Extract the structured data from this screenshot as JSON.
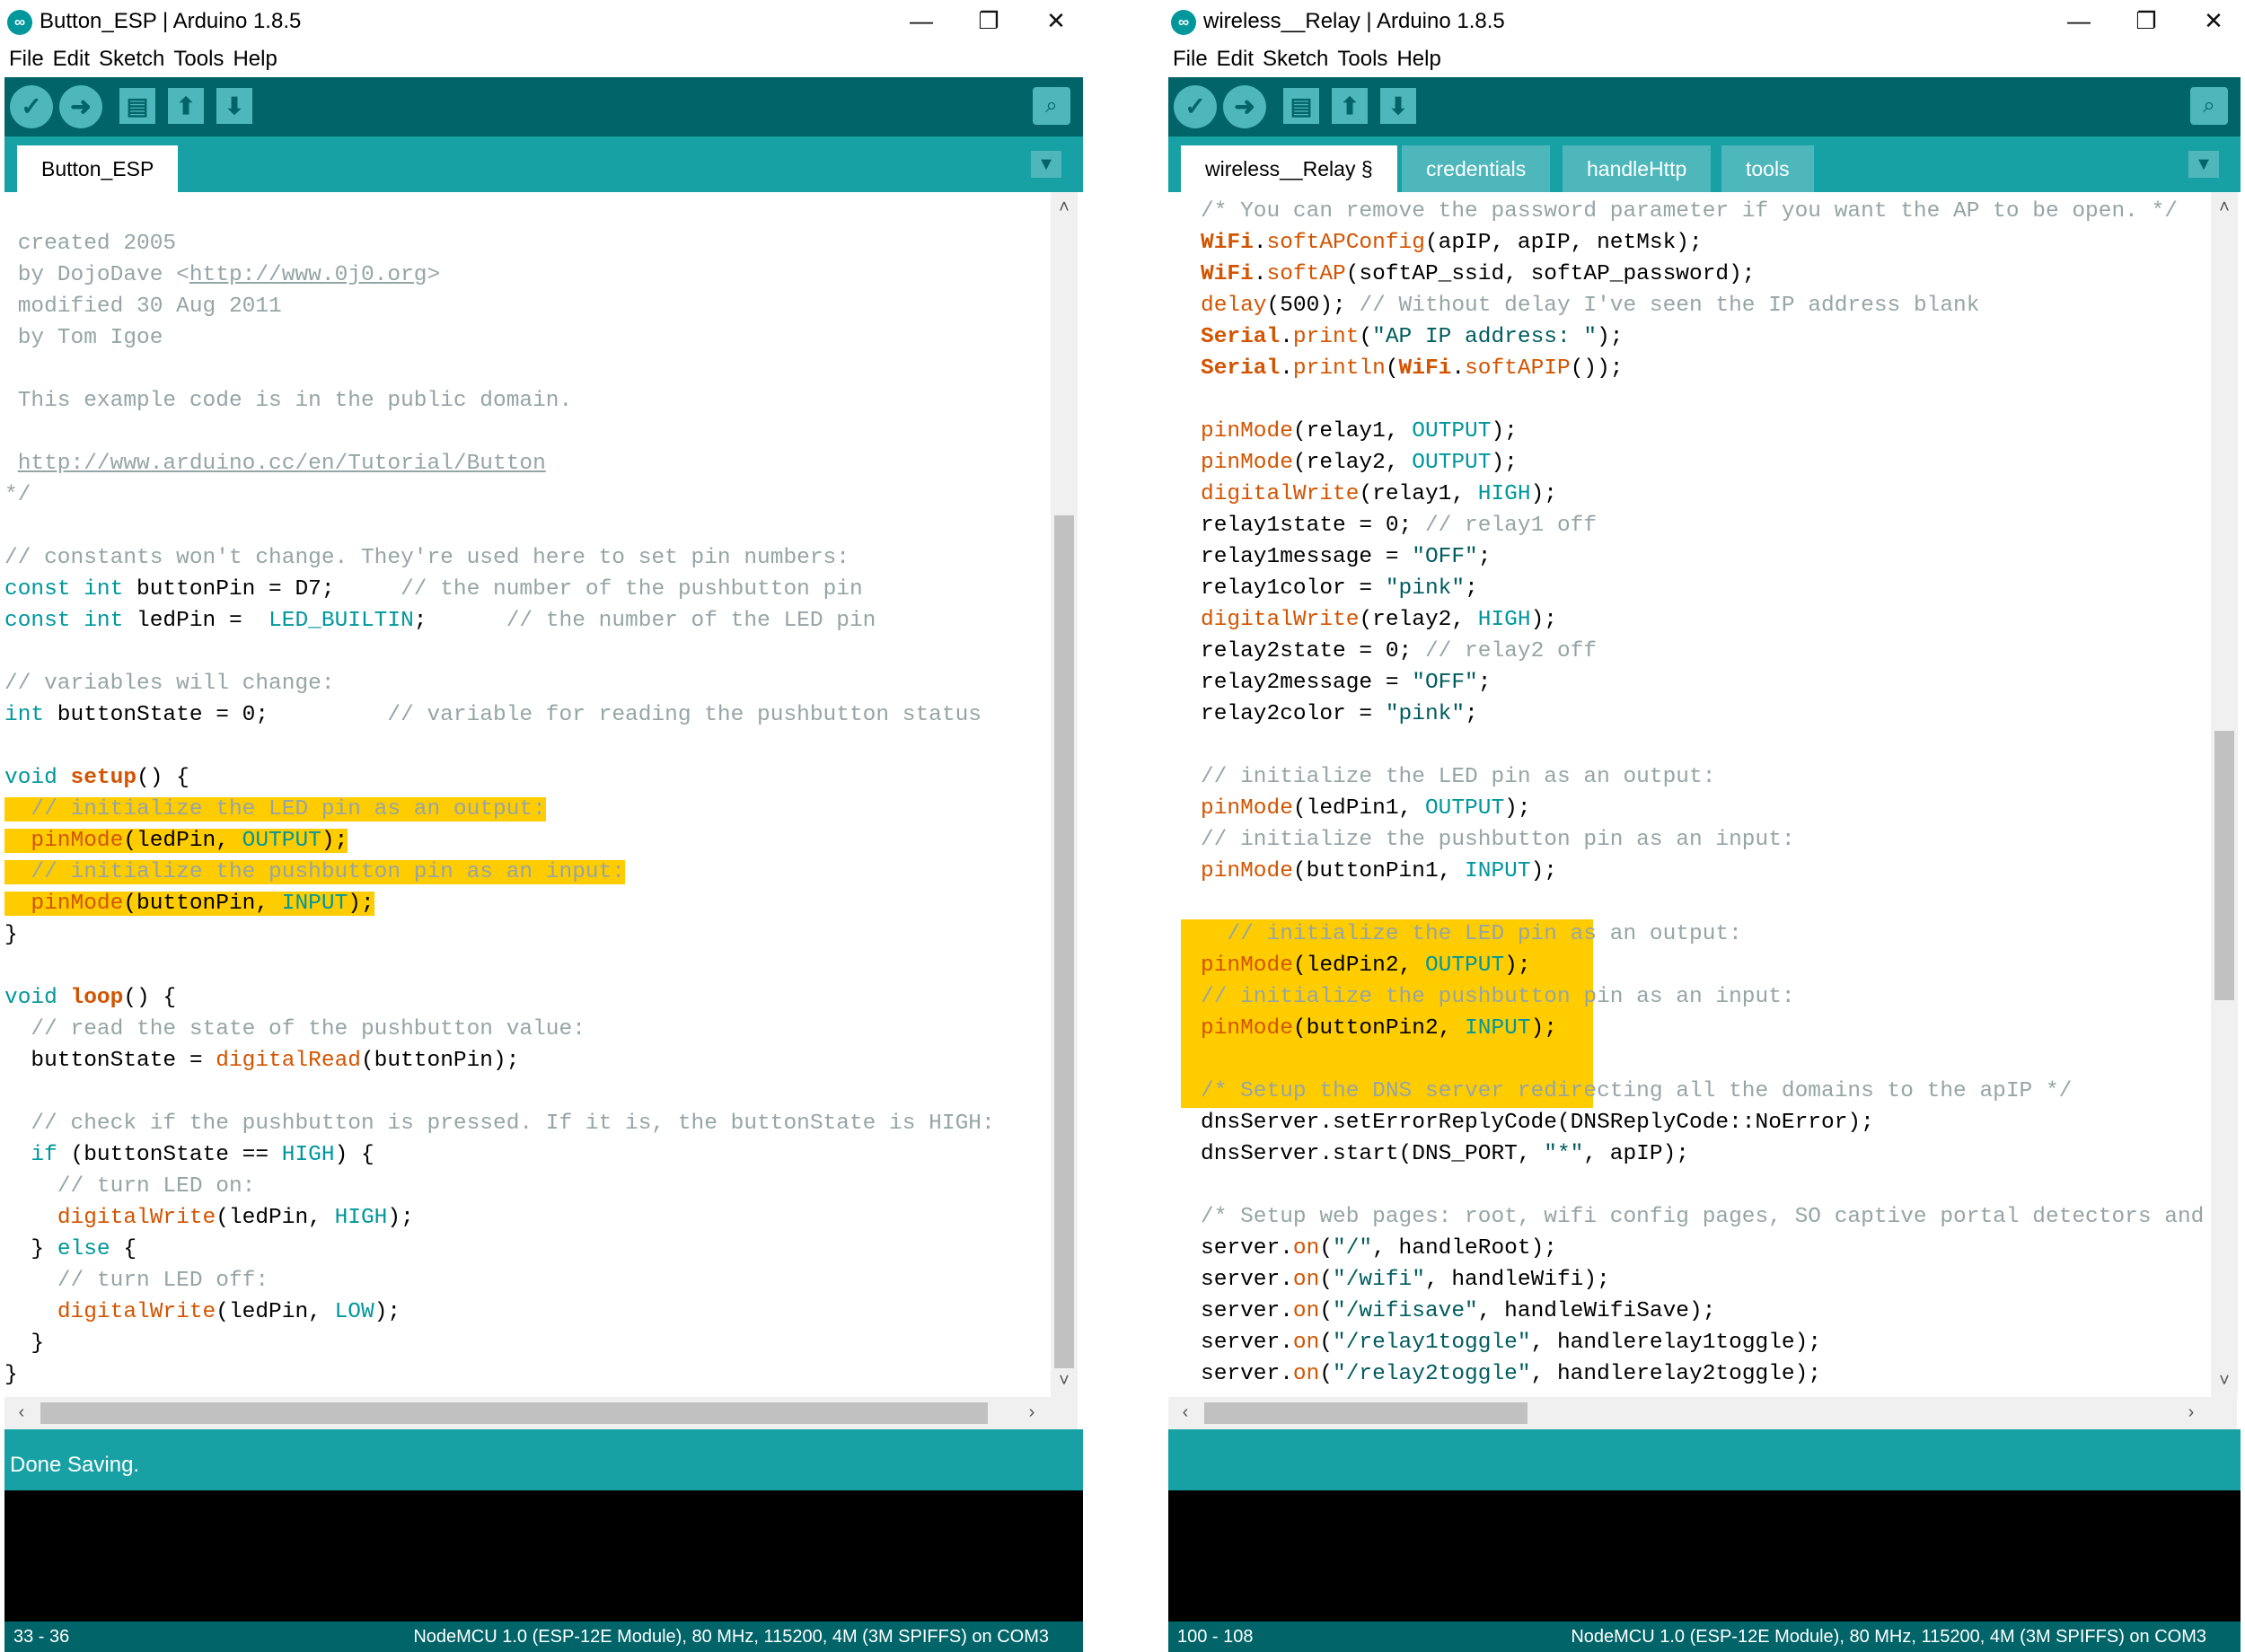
{
  "win1": {
    "title": "Button_ESP | Arduino 1.8.5",
    "menu": [
      "File",
      "Edit",
      "Sketch",
      "Tools",
      "Help"
    ],
    "tabs": [
      "Button_ESP"
    ],
    "code": [
      [
        [
          " created 2005",
          "cm"
        ]
      ],
      [
        [
          " by DojoDave <",
          "cm"
        ],
        [
          "http://www.0j0.org",
          "lk"
        ],
        [
          ">",
          "cm"
        ]
      ],
      [
        [
          " modified 30 Aug 2011",
          "cm"
        ]
      ],
      [
        [
          " by Tom Igoe",
          "cm"
        ]
      ],
      [],
      [
        [
          " This example code is in the public domain.",
          "cm"
        ]
      ],
      [],
      [
        [
          " ",
          "cm"
        ],
        [
          "http://www.arduino.cc/en/Tutorial/Button",
          "lk"
        ]
      ],
      [
        [
          "*/",
          "cm"
        ]
      ],
      [],
      [
        [
          "// constants won't change. They're used here to set pin numbers:",
          "cm"
        ]
      ],
      [
        [
          "const",
          "kw"
        ],
        [
          " "
        ],
        [
          "int",
          "kw"
        ],
        [
          " buttonPin = D7;     "
        ],
        [
          "// the number of the pushbutton pin",
          "cm"
        ]
      ],
      [
        [
          "const",
          "kw"
        ],
        [
          " "
        ],
        [
          "int",
          "kw"
        ],
        [
          " ledPin =  "
        ],
        [
          "LED_BUILTIN",
          "kw"
        ],
        [
          ";      "
        ],
        [
          "// the number of the LED pin",
          "cm"
        ]
      ],
      [],
      [
        [
          "// variables will change:",
          "cm"
        ]
      ],
      [
        [
          "int",
          "kw"
        ],
        [
          " buttonState = 0;         "
        ],
        [
          "// variable for reading the pushbutton status",
          "cm"
        ]
      ],
      [],
      [
        [
          "void",
          "kw"
        ],
        [
          " "
        ],
        [
          "setup",
          "kb"
        ],
        [
          "() {"
        ]
      ],
      [
        [
          "  // initialize the LED pin as an output:",
          "cm",
          "hl"
        ]
      ],
      [
        [
          "  "
        ],
        [
          "pinMode",
          "fn"
        ],
        [
          "(ledPin, "
        ],
        [
          "OUTPUT",
          "kw"
        ],
        [
          ");"
        ]
      ],
      [
        [
          "  // initialize the pushbutton pin as an input:",
          "cm",
          "hl"
        ]
      ],
      [
        [
          "  "
        ],
        [
          "pinMode",
          "fn"
        ],
        [
          "(buttonPin, "
        ],
        [
          "INPUT",
          "kw"
        ],
        [
          ");"
        ]
      ],
      [
        [
          "}"
        ]
      ],
      [],
      [
        [
          "void",
          "kw"
        ],
        [
          " "
        ],
        [
          "loop",
          "kb"
        ],
        [
          "() {"
        ]
      ],
      [
        [
          "  "
        ],
        [
          "// read the state of the pushbutton value:",
          "cm"
        ]
      ],
      [
        [
          "  buttonState = "
        ],
        [
          "digitalRead",
          "fn"
        ],
        [
          "(buttonPin);"
        ]
      ],
      [],
      [
        [
          "  "
        ],
        [
          "// check if the pushbutton is pressed. If it is, the buttonState is HIGH:",
          "cm"
        ]
      ],
      [
        [
          "  "
        ],
        [
          "if",
          "kw"
        ],
        [
          " (buttonState == "
        ],
        [
          "HIGH",
          "kw"
        ],
        [
          ") {"
        ]
      ],
      [
        [
          "    "
        ],
        [
          "// turn LED on:",
          "cm"
        ]
      ],
      [
        [
          "    "
        ],
        [
          "digitalWrite",
          "fn"
        ],
        [
          "(ledPin, "
        ],
        [
          "HIGH",
          "kw"
        ],
        [
          ");"
        ]
      ],
      [
        [
          "  } "
        ],
        [
          "else",
          "kw"
        ],
        [
          " {"
        ]
      ],
      [
        [
          "    "
        ],
        [
          "// turn LED off:",
          "cm"
        ]
      ],
      [
        [
          "    "
        ],
        [
          "digitalWrite",
          "fn"
        ],
        [
          "(ledPin, "
        ],
        [
          "LOW",
          "kw"
        ],
        [
          ");"
        ]
      ],
      [
        [
          "  }"
        ]
      ],
      [
        [
          "}"
        ]
      ]
    ],
    "status": "Done Saving.",
    "line_range": "33 - 36",
    "board": "NodeMCU 1.0 (ESP-12E Module), 80 MHz, 115200, 4M (3M SPIFFS) on COM3"
  },
  "win2": {
    "title": "wireless__Relay | Arduino 1.8.5",
    "menu": [
      "File",
      "Edit",
      "Sketch",
      "Tools",
      "Help"
    ],
    "tabs": [
      "wireless__Relay §",
      "credentials",
      "handleHttp",
      "tools"
    ],
    "code": [
      [
        [
          "/* You can remove the password parameter if you want the AP to be open. */",
          "cm"
        ]
      ],
      [
        [
          "WiFi",
          "kb"
        ],
        [
          "."
        ],
        [
          "softAPConfig",
          "fn"
        ],
        [
          "(apIP, apIP, netMsk);"
        ]
      ],
      [
        [
          "WiFi",
          "kb"
        ],
        [
          "."
        ],
        [
          "softAP",
          "fn"
        ],
        [
          "(softAP_ssid, softAP_password);"
        ]
      ],
      [
        [
          "delay",
          "fn"
        ],
        [
          "(500); "
        ],
        [
          "// Without delay I've seen the IP address blank",
          "cm"
        ]
      ],
      [
        [
          "Serial",
          "kb"
        ],
        [
          "."
        ],
        [
          "print",
          "fn"
        ],
        [
          "("
        ],
        [
          "\"AP IP address: \"",
          "st"
        ],
        [
          ");"
        ]
      ],
      [
        [
          "Serial",
          "kb"
        ],
        [
          "."
        ],
        [
          "println",
          "fn"
        ],
        [
          "("
        ],
        [
          "WiFi",
          "kb"
        ],
        [
          "."
        ],
        [
          "softAPIP",
          "fn"
        ],
        [
          "());"
        ]
      ],
      [],
      [
        [
          "pinMode",
          "fn"
        ],
        [
          "(relay1, "
        ],
        [
          "OUTPUT",
          "kw"
        ],
        [
          ");"
        ]
      ],
      [
        [
          "pinMode",
          "fn"
        ],
        [
          "(relay2, "
        ],
        [
          "OUTPUT",
          "kw"
        ],
        [
          ");"
        ]
      ],
      [
        [
          "digitalWrite",
          "fn"
        ],
        [
          "(relay1, "
        ],
        [
          "HIGH",
          "kw"
        ],
        [
          ");"
        ]
      ],
      [
        [
          "relay1state = 0; "
        ],
        [
          "// relay1 off",
          "cm"
        ]
      ],
      [
        [
          "relay1message = "
        ],
        [
          "\"OFF\"",
          "st"
        ],
        [
          ";"
        ]
      ],
      [
        [
          "relay1color = "
        ],
        [
          "\"pink\"",
          "st"
        ],
        [
          ";"
        ]
      ],
      [
        [
          "digitalWrite",
          "fn"
        ],
        [
          "(relay2, "
        ],
        [
          "HIGH",
          "kw"
        ],
        [
          ");"
        ]
      ],
      [
        [
          "relay2state = 0; "
        ],
        [
          "// relay2 off",
          "cm"
        ]
      ],
      [
        [
          "relay2message = "
        ],
        [
          "\"OFF\"",
          "st"
        ],
        [
          ";"
        ]
      ],
      [
        [
          "relay2color = "
        ],
        [
          "\"pink\"",
          "st"
        ],
        [
          ";"
        ]
      ],
      [],
      [
        [
          "// initialize the LED pin as an output:",
          "cm"
        ]
      ],
      [
        [
          "pinMode",
          "fn"
        ],
        [
          "(ledPin1, "
        ],
        [
          "OUTPUT",
          "kw"
        ],
        [
          ");"
        ]
      ],
      [
        [
          "// initialize the pushbutton pin as an input:",
          "cm"
        ]
      ],
      [
        [
          "pinMode",
          "fn"
        ],
        [
          "(buttonPin1, "
        ],
        [
          "INPUT",
          "kw"
        ],
        [
          ");"
        ]
      ],
      [],
      [
        [
          "  // initialize the LED pin as an output:",
          "cm"
        ]
      ],
      [
        [
          "pinMode",
          "fn"
        ],
        [
          "(ledPin2, "
        ],
        [
          "OUTPUT",
          "kw"
        ],
        [
          ");"
        ]
      ],
      [
        [
          "// initialize the pushbutton pin as an input:",
          "cm"
        ]
      ],
      [
        [
          "pinMode",
          "fn"
        ],
        [
          "(buttonPin2, "
        ],
        [
          "INPUT",
          "kw"
        ],
        [
          ");"
        ]
      ],
      [],
      [
        [
          "/* Setup the DNS server redirecting all the domains to the apIP */",
          "cm"
        ]
      ],
      [
        [
          "dnsServer.setErrorReplyCode(DNSReplyCode::NoError);"
        ]
      ],
      [
        [
          "dnsServer.start(DNS_PORT, "
        ],
        [
          "\"*\"",
          "st"
        ],
        [
          ", apIP);"
        ]
      ],
      [],
      [
        [
          "/* Setup web pages: root, wifi config pages, SO captive portal detectors and not found. */",
          "cm"
        ]
      ],
      [
        [
          "server."
        ],
        [
          "on",
          "fn"
        ],
        [
          "("
        ],
        [
          "\"/\"",
          "st"
        ],
        [
          ", handleRoot);"
        ]
      ],
      [
        [
          "server."
        ],
        [
          "on",
          "fn"
        ],
        [
          "("
        ],
        [
          "\"/wifi\"",
          "st"
        ],
        [
          ", handleWifi);"
        ]
      ],
      [
        [
          "server."
        ],
        [
          "on",
          "fn"
        ],
        [
          "("
        ],
        [
          "\"/wifisave\"",
          "st"
        ],
        [
          ", handleWifiSave);"
        ]
      ],
      [
        [
          "server."
        ],
        [
          "on",
          "fn"
        ],
        [
          "("
        ],
        [
          "\"/relay1toggle\"",
          "st"
        ],
        [
          ", handlerelay1toggle);"
        ]
      ],
      [
        [
          "server."
        ],
        [
          "on",
          "fn"
        ],
        [
          "("
        ],
        [
          "\"/relay2toggle\"",
          "st"
        ],
        [
          ", handlerelay2toggle);"
        ]
      ]
    ],
    "status": "",
    "line_range": "100 - 108",
    "board": "NodeMCU 1.0 (ESP-12E Module), 80 MHz, 115200, 4M (3M SPIFFS) on COM3"
  },
  "toolbar_icons": [
    "verify-icon",
    "upload-icon",
    "new-icon",
    "open-icon",
    "save-icon",
    "serial-monitor-icon"
  ],
  "colors": {
    "toolbar": "#006468",
    "tabbar": "#17a1a5",
    "highlight": "#ffcc00",
    "comment": "#95a5a6",
    "keyword": "#00979c",
    "function": "#d35400"
  }
}
